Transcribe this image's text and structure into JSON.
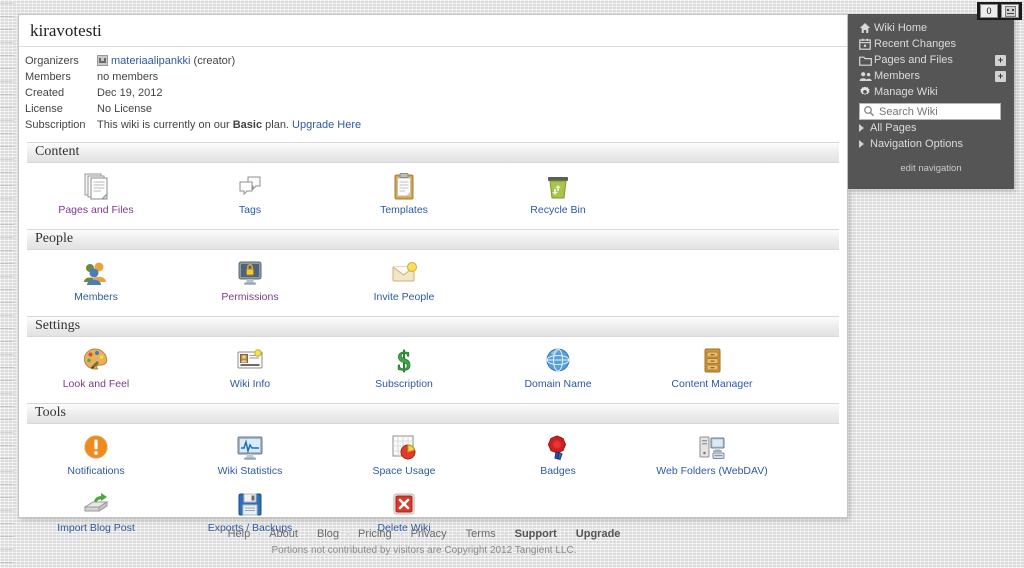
{
  "topbar": {
    "counter_badge": "0",
    "face_badge_name": "face-icon"
  },
  "wiki": {
    "title": "kiravotesti",
    "info": [
      {
        "label": "Organizers",
        "value": "materiaalipankki",
        "suffix": " (creator)",
        "is_link": true
      },
      {
        "label": "Members",
        "value": "no members",
        "is_link": false
      },
      {
        "label": "Created",
        "value": "Dec 19, 2012",
        "is_link": false
      },
      {
        "label": "License",
        "value": "No License",
        "is_link": false
      },
      {
        "label": "Subscription",
        "value": "This wiki is currently on our ",
        "plan": "Basic",
        "value_tail": " plan. ",
        "link": "Upgrade Here",
        "is_link": false
      }
    ]
  },
  "sections": [
    {
      "title": "Content",
      "rows": [
        [
          {
            "label": "Pages and Files",
            "icon": "pages-and-files-icon",
            "visited": true
          },
          {
            "label": "Tags",
            "icon": "tags-icon",
            "visited": false
          },
          {
            "label": "Templates",
            "icon": "templates-icon",
            "visited": false
          },
          {
            "label": "Recycle Bin",
            "icon": "recycle-bin-icon",
            "visited": false
          }
        ]
      ]
    },
    {
      "title": "People",
      "rows": [
        [
          {
            "label": "Members",
            "icon": "members-icon",
            "visited": false
          },
          {
            "label": "Permissions",
            "icon": "permissions-icon",
            "visited": true
          },
          {
            "label": "Invite People",
            "icon": "invite-people-icon",
            "visited": false
          }
        ]
      ]
    },
    {
      "title": "Settings",
      "rows": [
        [
          {
            "label": "Look and Feel",
            "icon": "look-and-feel-icon",
            "visited": true
          },
          {
            "label": "Wiki Info",
            "icon": "wiki-info-icon",
            "visited": false
          },
          {
            "label": "Subscription",
            "icon": "subscription-icon",
            "visited": false
          },
          {
            "label": "Domain Name",
            "icon": "domain-name-icon",
            "visited": false
          },
          {
            "label": "Content Manager",
            "icon": "content-manager-icon",
            "visited": false
          }
        ]
      ]
    },
    {
      "title": "Tools",
      "rows": [
        [
          {
            "label": "Notifications",
            "icon": "notifications-icon",
            "visited": false
          },
          {
            "label": "Wiki Statistics",
            "icon": "wiki-statistics-icon",
            "visited": false
          },
          {
            "label": "Space Usage",
            "icon": "space-usage-icon",
            "visited": false
          },
          {
            "label": "Badges",
            "icon": "badges-icon",
            "visited": false
          },
          {
            "label": "Web Folders (WebDAV)",
            "icon": "web-folders-icon",
            "visited": false
          }
        ],
        [
          {
            "label": "Import Blog Post",
            "icon": "import-blog-post-icon",
            "visited": false
          },
          {
            "label": "Exports / Backups",
            "icon": "exports-backups-icon",
            "visited": false
          },
          {
            "label": "Delete Wiki",
            "icon": "delete-wiki-icon",
            "visited": false
          }
        ]
      ]
    }
  ],
  "sidebar": {
    "items": [
      {
        "label": "Wiki Home",
        "icon": "home-icon",
        "plus": false
      },
      {
        "label": "Recent Changes",
        "icon": "calendar-icon",
        "plus": false
      },
      {
        "label": "Pages and Files",
        "icon": "folder-icon",
        "plus": true
      },
      {
        "label": "Members",
        "icon": "people-icon",
        "plus": true
      },
      {
        "label": "Manage Wiki",
        "icon": "gear-icon",
        "plus": false
      }
    ],
    "search_placeholder": "Search Wiki",
    "search_value": "",
    "disclosures": [
      {
        "label": "All Pages"
      },
      {
        "label": "Navigation Options"
      }
    ],
    "edit_navigation": "edit navigation",
    "plus_label": "+"
  },
  "footer": {
    "links": [
      {
        "label": "Help",
        "strong": false
      },
      {
        "label": "About",
        "strong": false
      },
      {
        "label": "Blog",
        "strong": false
      },
      {
        "label": "Pricing",
        "strong": false
      },
      {
        "label": "Privacy",
        "strong": false
      },
      {
        "label": "Terms",
        "strong": false
      },
      {
        "label": "Support",
        "strong": true
      },
      {
        "label": "Upgrade",
        "strong": true
      }
    ],
    "copyright": "Portions not contributed by visitors are Copyright 2012 Tangient LLC."
  },
  "colors": {
    "link": "#2c5aa0",
    "visited_link": "#7b3a8c",
    "sidebar_bg": "#555555",
    "page_bg": "#e6e6e6"
  }
}
